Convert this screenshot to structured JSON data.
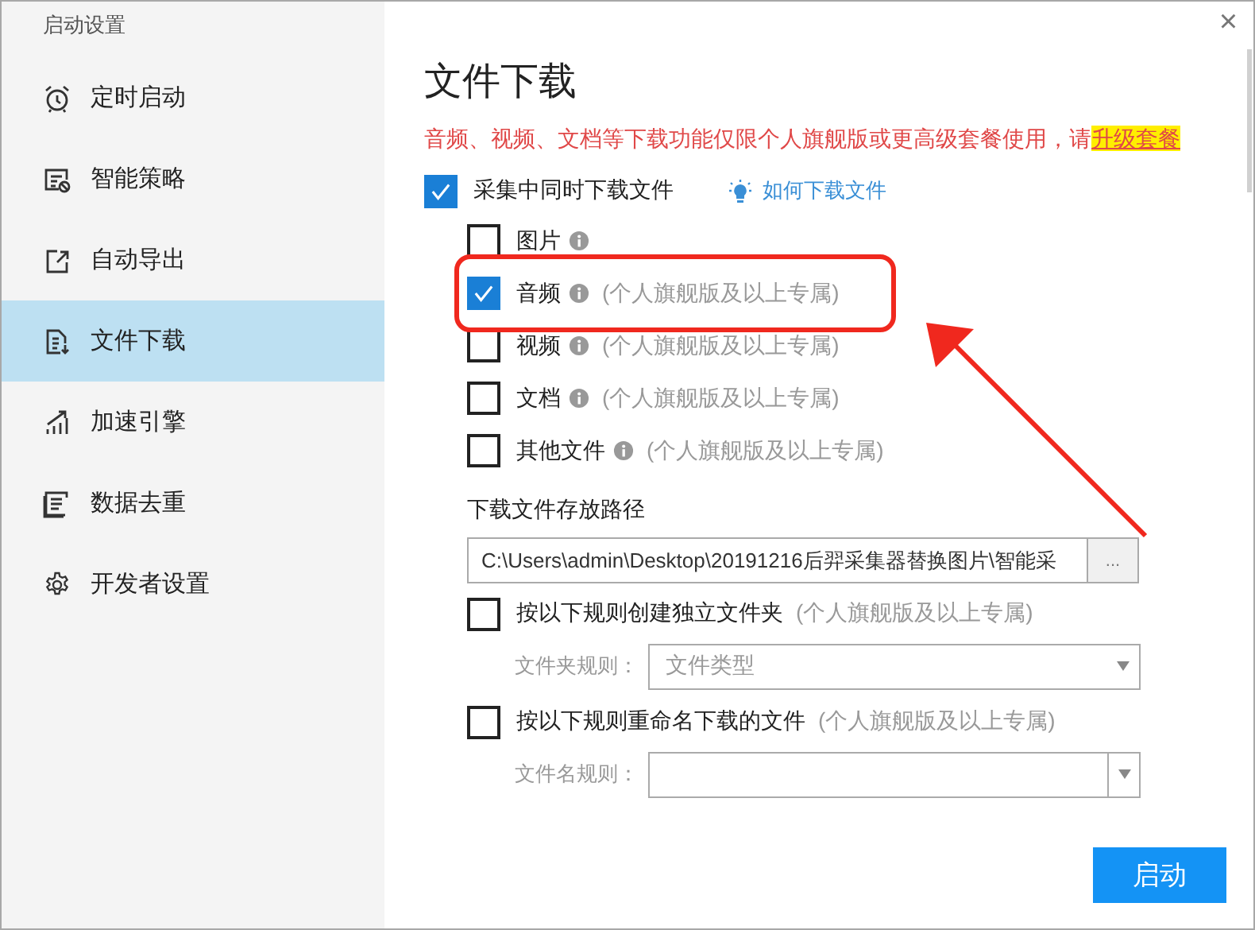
{
  "window": {
    "title": "启动设置",
    "close": "×"
  },
  "sidebar": {
    "items": [
      {
        "label": "定时启动",
        "selected": false
      },
      {
        "label": "智能策略",
        "selected": false
      },
      {
        "label": "自动导出",
        "selected": false
      },
      {
        "label": "文件下载",
        "selected": true
      },
      {
        "label": "加速引擎",
        "selected": false
      },
      {
        "label": "数据去重",
        "selected": false
      },
      {
        "label": "开发者设置",
        "selected": false
      }
    ]
  },
  "heading": "文件下载",
  "notice": {
    "text": "音频、视频、文档等下载功能仅限个人旗舰版或更高级套餐使用，请",
    "link": "升级套餐"
  },
  "download_files": {
    "label": "采集中同时下载文件",
    "checked": true,
    "help_link": "如何下载文件"
  },
  "file_types": [
    {
      "label": "图片",
      "checked": false,
      "highlighted": false
    },
    {
      "label": "音频",
      "checked": true,
      "note": "(个人旗舰版及以上专属)",
      "highlighted": true
    },
    {
      "label": "视频",
      "checked": false,
      "note": "(个人旗舰版及以上专属)",
      "highlighted": false
    },
    {
      "label": "文档",
      "checked": false,
      "note": "(个人旗舰版及以上专属)",
      "highlighted": false
    },
    {
      "label": "其他文件",
      "checked": false,
      "note": "(个人旗舰版及以上专属)",
      "highlighted": false
    }
  ],
  "save_path": {
    "label": "下载文件存放路径",
    "value": "C:\\Users\\admin\\Desktop\\20191216后羿采集器替换图片\\智能采",
    "browse": "..."
  },
  "rules": [
    {
      "label": "按以下规则创建独立文件夹",
      "note": "(个人旗舰版及以上专属)",
      "checked": false,
      "field_label": "文件夹规则：",
      "value": "文件类型",
      "kind": "select"
    },
    {
      "label": "按以下规则重命名下载的文件",
      "note": "(个人旗舰版及以上专属)",
      "checked": false,
      "field_label": "文件名规则：",
      "kind": "combo"
    }
  ],
  "start_button": "启动"
}
